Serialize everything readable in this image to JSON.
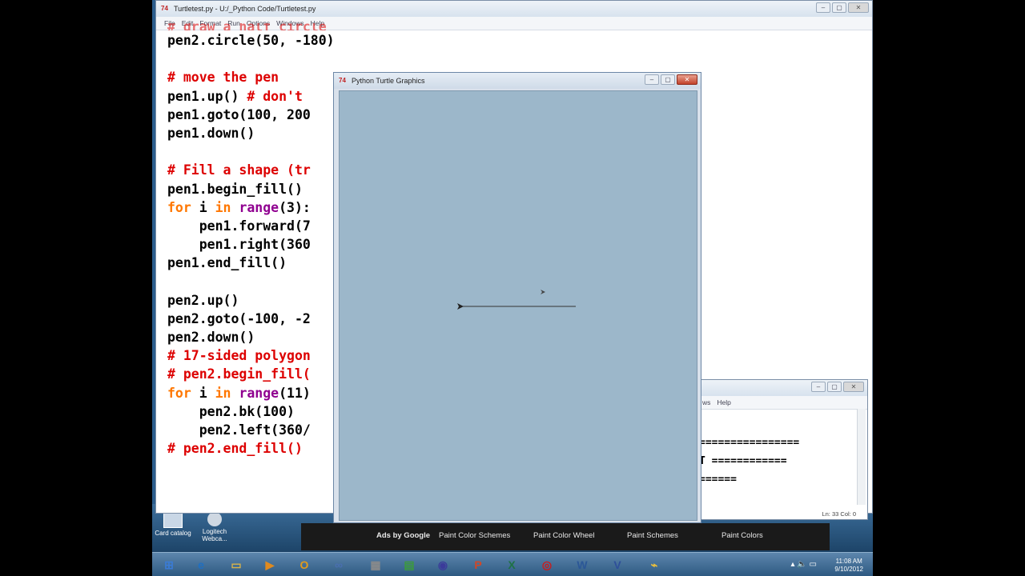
{
  "editor": {
    "title": "Turtletest.py - U:/_Python Code/Turtletest.py",
    "menu": [
      "File",
      "Edit",
      "Format",
      "Run",
      "Options",
      "Windows",
      "Help"
    ],
    "partial_top_line": "# draw a half circle",
    "lines": [
      [
        {
          "t": "pen2.circle(50, -180)",
          "c": ""
        }
      ],
      [
        {
          "t": "",
          "c": ""
        }
      ],
      [
        {
          "t": "# move the pen",
          "c": "cm"
        }
      ],
      [
        {
          "t": "pen1.up() ",
          "c": ""
        },
        {
          "t": "# don't",
          "c": "cm"
        }
      ],
      [
        {
          "t": "pen1.goto(100, 200",
          "c": ""
        }
      ],
      [
        {
          "t": "pen1.down()",
          "c": ""
        }
      ],
      [
        {
          "t": "",
          "c": ""
        }
      ],
      [
        {
          "t": "# Fill a shape (tr",
          "c": "cm"
        }
      ],
      [
        {
          "t": "pen1.begin_fill()",
          "c": ""
        }
      ],
      [
        {
          "t": "for",
          "c": "kw"
        },
        {
          "t": " i ",
          "c": ""
        },
        {
          "t": "in",
          "c": "kw"
        },
        {
          "t": " ",
          "c": ""
        },
        {
          "t": "range",
          "c": "bi"
        },
        {
          "t": "(3):",
          "c": ""
        }
      ],
      [
        {
          "t": "    pen1.forward(7",
          "c": ""
        }
      ],
      [
        {
          "t": "    pen1.right(360",
          "c": ""
        }
      ],
      [
        {
          "t": "pen1.end_fill()",
          "c": ""
        }
      ],
      [
        {
          "t": "",
          "c": ""
        }
      ],
      [
        {
          "t": "pen2.up()",
          "c": ""
        }
      ],
      [
        {
          "t": "pen2.goto(-100, -2",
          "c": ""
        }
      ],
      [
        {
          "t": "pen2.down()",
          "c": ""
        }
      ],
      [
        {
          "t": "# 17-sided polygon",
          "c": "cm"
        }
      ],
      [
        {
          "t": "# pen2.begin_fill(",
          "c": "cm"
        }
      ],
      [
        {
          "t": "for",
          "c": "kw"
        },
        {
          "t": " i ",
          "c": ""
        },
        {
          "t": "in",
          "c": "kw"
        },
        {
          "t": " ",
          "c": ""
        },
        {
          "t": "range",
          "c": "bi"
        },
        {
          "t": "(11)",
          "c": ""
        }
      ],
      [
        {
          "t": "    pen2.bk(100)",
          "c": ""
        }
      ],
      [
        {
          "t": "    pen2.left(360/",
          "c": ""
        }
      ],
      [
        {
          "t": "# pen2.end_fill()",
          "c": "cm"
        }
      ]
    ]
  },
  "turtle_window": {
    "title": "Python Turtle Graphics",
    "icon": "tk-feather-icon"
  },
  "shell_window": {
    "menu_partial": [
      "ws",
      "Help"
    ],
    "lines": [
      "================",
      "T ============",
      "======"
    ],
    "status": "Ln: 33 Col: 0"
  },
  "desktop_icons": [
    {
      "label": "Card catalog",
      "icon": "card-catalog-icon"
    },
    {
      "label": "Logitech Webca...",
      "icon": "webcam-icon"
    }
  ],
  "ads": [
    "Ads by Google",
    "Paint Color Schemes",
    "Paint Color Wheel",
    "Paint Schemes",
    "Paint Colors"
  ],
  "taskbar": {
    "buttons": [
      {
        "icon": "start-orb-icon",
        "glyph": "⊞",
        "color": "#3a7bd5"
      },
      {
        "icon": "internet-explorer-icon",
        "glyph": "e",
        "color": "#1f6fc2"
      },
      {
        "icon": "file-explorer-icon",
        "glyph": "▭",
        "color": "#d8b34a"
      },
      {
        "icon": "media-player-icon",
        "glyph": "▶",
        "color": "#e08a1e"
      },
      {
        "icon": "outlook-icon",
        "glyph": "O",
        "color": "#e39b1a"
      },
      {
        "icon": "network-icon",
        "glyph": "∞",
        "color": "#4a6fb0"
      },
      {
        "icon": "calculator-icon",
        "glyph": "▦",
        "color": "#8a8a8a"
      },
      {
        "icon": "chart-icon",
        "glyph": "▤",
        "color": "#3c9a3c"
      },
      {
        "icon": "eclipse-icon",
        "glyph": "◉",
        "color": "#3b3b9a"
      },
      {
        "icon": "powerpoint-icon",
        "glyph": "P",
        "color": "#d24726"
      },
      {
        "icon": "excel-icon",
        "glyph": "X",
        "color": "#1e7145"
      },
      {
        "icon": "opera-icon",
        "glyph": "◎",
        "color": "#cc1b1b"
      },
      {
        "icon": "word-icon",
        "glyph": "W",
        "color": "#2b5797"
      },
      {
        "icon": "visio-icon",
        "glyph": "V",
        "color": "#2e4f9a"
      },
      {
        "icon": "python-icon",
        "glyph": "⌁",
        "color": "#f0c23a"
      }
    ],
    "time": "11:08 AM",
    "date": "9/10/2012"
  }
}
